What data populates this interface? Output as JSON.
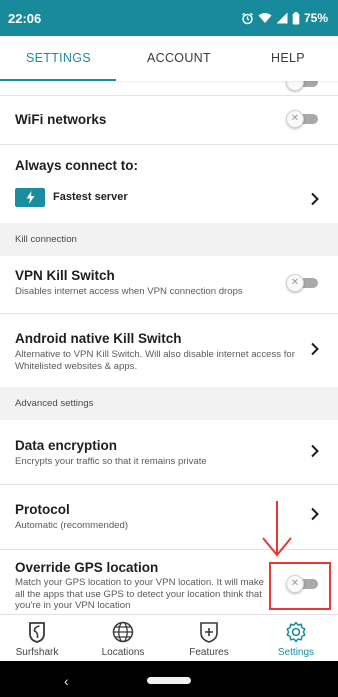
{
  "status_bar": {
    "time": "22:06",
    "battery": "75%"
  },
  "tabs": [
    {
      "label": "SETTINGS",
      "active": true
    },
    {
      "label": "ACCOUNT",
      "active": false
    },
    {
      "label": "HELP",
      "active": false
    }
  ],
  "settings": {
    "wifi": {
      "label": "WiFi networks",
      "enabled": false
    },
    "always_connect": {
      "label": "Always connect to:",
      "server": "Fastest server",
      "server_icon": "lightning-icon"
    },
    "kill_section": "Kill connection",
    "vpn_kill_switch": {
      "label": "VPN Kill Switch",
      "description": "Disables internet access when VPN connection drops",
      "enabled": false
    },
    "android_kill_switch": {
      "label": "Android native Kill Switch",
      "description": "Alternative to VPN Kill Switch. Will also disable internet access for Whitelisted websites & apps."
    },
    "advanced_section": "Advanced settings",
    "data_encryption": {
      "label": "Data encryption",
      "description": "Encrypts your traffic so that it remains private"
    },
    "protocol": {
      "label": "Protocol",
      "description": "Automatic (recommended)"
    },
    "override_gps": {
      "label": "Override GPS location",
      "description": "Match your GPS location to your VPN location. It will make all the apps that use GPS to detect your location think that you're in your VPN location",
      "enabled": false
    }
  },
  "bottom_nav": [
    {
      "label": "Surfshark",
      "icon": "surfshark-logo-icon",
      "active": false
    },
    {
      "label": "Locations",
      "icon": "globe-icon",
      "active": false
    },
    {
      "label": "Features",
      "icon": "shield-plus-icon",
      "active": false
    },
    {
      "label": "Settings",
      "icon": "gear-icon",
      "active": true
    }
  ],
  "colors": {
    "accent": "#1a8ea0",
    "status_bar": "#178a9b",
    "annotation": "#e53935"
  }
}
